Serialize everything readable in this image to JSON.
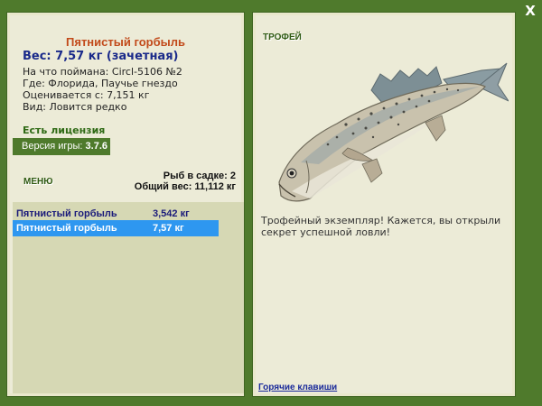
{
  "window": {
    "close_label": "X"
  },
  "fish_info": {
    "title": "Пятнистый горбыль",
    "weight": "Вес: 7,57 кг (зачетная)",
    "caught_on": "На что поймана: Circl-5106 №2",
    "location": "Где: Флорида, Паучье гнездо",
    "value": "Оценивается с: 7,151 кг",
    "rarity": "Вид: Ловится редко"
  },
  "license": "Есть лицензия",
  "version": {
    "label": "Версия игры:",
    "number": "3.7.6"
  },
  "menu_label": "МЕНЮ",
  "cage": {
    "fish_count": "Рыб в садке: 2",
    "total_weight": "Общий вес: 11,112 кг"
  },
  "catch_list": [
    {
      "name": "Пятнистый горбыль",
      "weight": "3,542 кг",
      "selected": false
    },
    {
      "name": "Пятнистый горбыль",
      "weight": "7,57 кг",
      "selected": true
    }
  ],
  "trophy": {
    "label": "ТРОФЕЙ",
    "text": "Трофейный экземпляр! Кажется, вы открыли секрет успешной ловли!"
  },
  "hotkeys_label": "Горячие клавиши",
  "colors": {
    "background": "#4f7a2c",
    "panel": "#ecebd7",
    "selection": "#2e97f0",
    "title": "#c24a1a"
  }
}
